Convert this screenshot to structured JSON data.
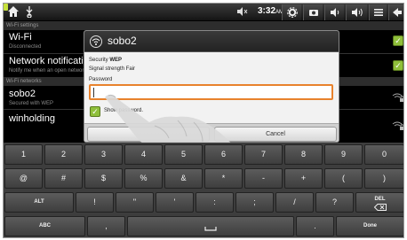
{
  "statusbar": {
    "time": "3:32",
    "time_suffix": "AM",
    "icons": [
      "home-icon",
      "usb-icon",
      "mute-icon",
      "battery-icon",
      "settings-icon",
      "camera-icon",
      "volume-down-icon",
      "volume-up-icon",
      "menu-icon",
      "back-icon"
    ],
    "battery_color": "#c7e23d"
  },
  "settings": {
    "wifi_settings_header": "Wi-Fi settings",
    "wifi_title": "Wi-Fi",
    "wifi_sub": "Disconnected",
    "notify_title": "Network notification",
    "notify_sub": "Notify me when an open network is available",
    "networks_header": "Wi-Fi networks",
    "networks": [
      {
        "name": "sobo2",
        "sub": "Secured with WEP"
      },
      {
        "name": "winholding",
        "sub": ""
      }
    ],
    "checkbox_color": "#8fbf3a"
  },
  "dialog": {
    "title": "sobo2",
    "security_label": "Security",
    "security_value": "WEP",
    "signal_label": "Signal strength",
    "signal_value": "Fair",
    "password_label": "Password",
    "password_value": "",
    "show_password_label": "Show password.",
    "connect_label": "",
    "cancel_label": "Cancel",
    "focus_color": "#e8822c"
  },
  "keyboard": {
    "row1": [
      "1",
      "2",
      "3",
      "4",
      "5",
      "6",
      "7",
      "8",
      "9",
      "0"
    ],
    "row2": [
      "@",
      "#",
      "$",
      "%",
      "&",
      "*",
      "-",
      "+",
      "(",
      ")"
    ],
    "row3": [
      "ALT",
      "!",
      "\"",
      "'",
      ":",
      ";",
      "/",
      "?",
      "DEL"
    ],
    "row4": [
      "ABC",
      ",",
      "_",
      ".",
      "Done"
    ]
  }
}
